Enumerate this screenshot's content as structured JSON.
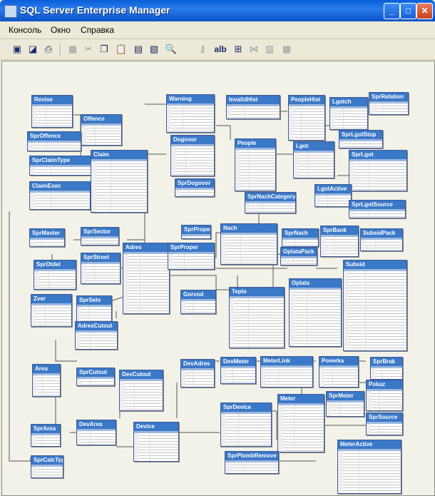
{
  "window": {
    "title": "SQL Server Enterprise Manager",
    "minimize_glyph": "_",
    "maximize_glyph": "□",
    "close_glyph": "✕"
  },
  "menu": {
    "items": [
      "Консоль",
      "Окно",
      "Справка"
    ]
  },
  "toolbar": {
    "icons": [
      "save-icon",
      "properties-icon",
      "print-icon",
      "cut-disabled-icon",
      "cut-icon",
      "copy-icon",
      "paste-icon",
      "add-table-icon",
      "new-table-icon",
      "zoom-icon",
      "key-icon",
      "alb",
      "table-view-icon",
      "arrange-icon",
      "autosize-icon",
      "grid-icon"
    ],
    "alb_label": "alb"
  },
  "diagram": {
    "tables": [
      "Revise",
      "Offence",
      "SprOffence",
      "SprClaimType",
      "ClaimExec",
      "Claim",
      "Warning",
      "InvalidHist",
      "PeopleHist",
      "Lgotch",
      "SprRelation",
      "Dogovor",
      "People",
      "Lgot",
      "SprLgotStop",
      "SprLgot",
      "SprDogovor",
      "SprNachCategory",
      "LgotActive",
      "SprLgotSource",
      "SprMaster",
      "SprSector",
      "Adres",
      "SprProper",
      "SprProper",
      "Nach",
      "SprNach",
      "SprBank",
      "SubsidPack",
      "SprOtdel",
      "SprStreet",
      "OplataPack",
      "Subsid",
      "Zver",
      "SprSelo",
      "Gorvod",
      "Teplo",
      "Oplata",
      "AdresCutout",
      "Area",
      "SprCutout",
      "DevCutout",
      "DevAdres",
      "DevMeter",
      "MeterLink",
      "Poverka",
      "SprBrak",
      "Pokaz",
      "SprMeter",
      "SprArea",
      "DevArea",
      "Device",
      "SprDevice",
      "Meter",
      "SprSource",
      "SprCalcType",
      "SprPlombRemove",
      "MeterActive"
    ]
  }
}
